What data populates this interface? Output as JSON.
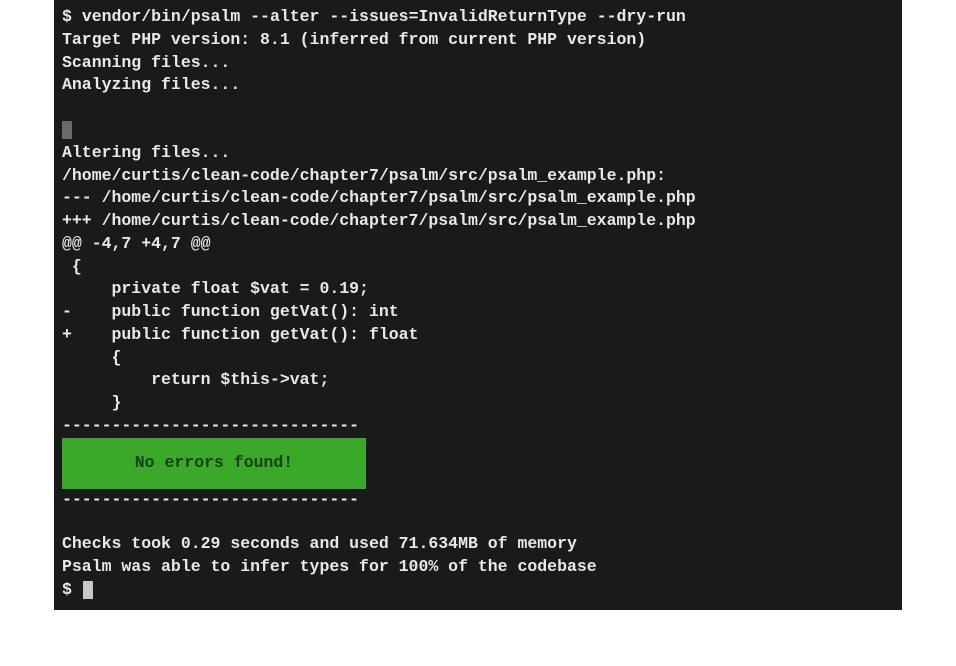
{
  "terminal": {
    "prompt": "$",
    "command": "vendor/bin/psalm --alter --issues=InvalidReturnType --dry-run",
    "output": {
      "target_line": "Target PHP version: 8.1 (inferred from current PHP version)",
      "scanning": "Scanning files...",
      "analyzing": "Analyzing files...",
      "altering": "Altering files...",
      "file_path": "/home/curtis/clean-code/chapter7/psalm/src/psalm_example.php:",
      "diff_minus_file": "--- /home/curtis/clean-code/chapter7/psalm/src/psalm_example.php",
      "diff_plus_file": "+++ /home/curtis/clean-code/chapter7/psalm/src/psalm_example.php",
      "hunk_header": "@@ -4,7 +4,7 @@",
      "brace_open": " {",
      "vat_field": "     private float $vat = 0.19;",
      "empty_ctx": "",
      "removed_line": "-    public function getVat(): int",
      "added_line": "+    public function getVat(): float",
      "method_open": "     {",
      "return_line": "         return $this->vat;",
      "method_close": "     }",
      "dash_separator": "------------------------------",
      "success_msg": "No errors found!",
      "checks_line": "Checks took 0.29 seconds and used 71.634MB of memory",
      "infer_line": "Psalm was able to infer types for 100% of the codebase"
    }
  }
}
